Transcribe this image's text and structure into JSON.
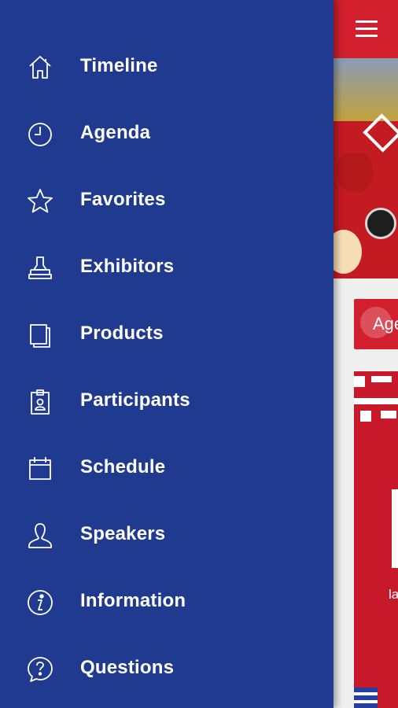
{
  "menu": {
    "items": [
      {
        "label": "Timeline",
        "icon": "home-icon"
      },
      {
        "label": "Agenda",
        "icon": "clock-icon"
      },
      {
        "label": "Favorites",
        "icon": "star-icon"
      },
      {
        "label": "Exhibitors",
        "icon": "stamp-icon"
      },
      {
        "label": "Products",
        "icon": "book-icon"
      },
      {
        "label": "Participants",
        "icon": "badge-icon"
      },
      {
        "label": "Schedule",
        "icon": "calendar-icon"
      },
      {
        "label": "Speakers",
        "icon": "person-icon"
      },
      {
        "label": "Information",
        "icon": "info-icon"
      },
      {
        "label": "Questions",
        "icon": "help-icon"
      }
    ]
  },
  "app": {
    "agenda_button_label": "Age",
    "card_caption": "la"
  },
  "colors": {
    "drawer_bg": "#1f3a8f",
    "accent_red": "#d11f2e",
    "content_bg": "#efefef"
  }
}
